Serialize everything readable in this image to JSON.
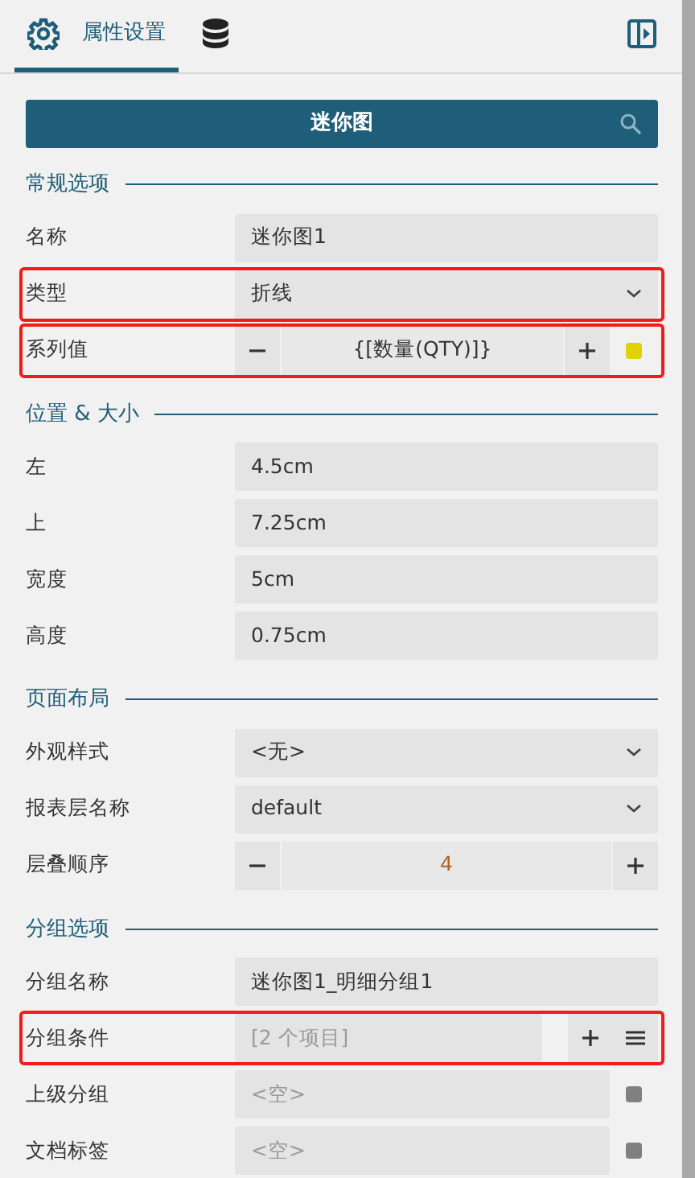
{
  "tabs": [
    {
      "kind": "properties",
      "label": "属性设置",
      "selected": true
    },
    {
      "kind": "data",
      "selected": false
    }
  ],
  "title": "迷你图",
  "sections": [
    {
      "title": "常规选项",
      "rows": [
        {
          "kind": "text",
          "label": "名称",
          "value": "迷你图1",
          "highlighted": false
        },
        {
          "kind": "select",
          "label": "类型",
          "value": "折线",
          "highlighted": true
        },
        {
          "kind": "expression",
          "label": "系列值",
          "value": "{[数量(QTY)]}",
          "color": "#e0d400",
          "highlighted": true
        }
      ]
    },
    {
      "title": "位置 & 大小",
      "rows": [
        {
          "kind": "text",
          "label": "左",
          "value": "4.5cm",
          "highlighted": false
        },
        {
          "kind": "text",
          "label": "上",
          "value": "7.25cm",
          "highlighted": false
        },
        {
          "kind": "text",
          "label": "宽度",
          "value": "5cm",
          "highlighted": false
        },
        {
          "kind": "text",
          "label": "高度",
          "value": "0.75cm",
          "highlighted": false
        }
      ]
    },
    {
      "title": "页面布局",
      "rows": [
        {
          "kind": "select",
          "label": "外观样式",
          "value": "<无>",
          "highlighted": false
        },
        {
          "kind": "select",
          "label": "报表层名称",
          "value": "default",
          "highlighted": false
        },
        {
          "kind": "spinner",
          "label": "层叠顺序",
          "value": "4",
          "highlighted": false
        }
      ]
    },
    {
      "title": "分组选项",
      "rows": [
        {
          "kind": "text",
          "label": "分组名称",
          "value": "迷你图1_明细分组1",
          "highlighted": false
        },
        {
          "kind": "collection",
          "label": "分组条件",
          "placeholder": "[2 个项目]",
          "highlighted": true
        },
        {
          "kind": "empty",
          "label": "上级分组",
          "placeholder": "<空>",
          "color": "#808080",
          "highlighted": false
        },
        {
          "kind": "empty",
          "label": "文档标签",
          "placeholder": "<空>",
          "color": "#808080",
          "highlighted": false
        }
      ]
    }
  ]
}
